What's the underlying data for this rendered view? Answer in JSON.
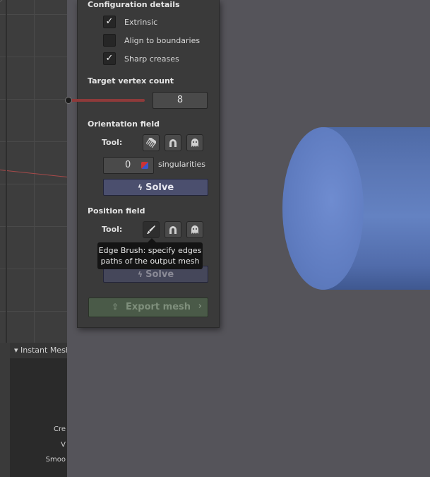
{
  "config": {
    "title": "Configuration details",
    "options": [
      {
        "label": "Extrinsic",
        "checked": true
      },
      {
        "label": "Align to boundaries",
        "checked": false
      },
      {
        "label": "Sharp creases",
        "checked": true
      }
    ]
  },
  "target": {
    "title": "Target vertex count",
    "value": "8"
  },
  "orientation": {
    "title": "Orientation field",
    "tool_label": "Tool:",
    "tools": [
      "comb-icon",
      "magnet-icon",
      "ghost-icon"
    ],
    "singularities_value": "0",
    "singularities_label": "singularities",
    "solve_label": "Solve"
  },
  "position": {
    "title": "Position field",
    "tool_label": "Tool:",
    "tools": [
      "brush-icon",
      "magnet-icon",
      "ghost-icon"
    ],
    "solve_label": "Solve"
  },
  "tooltip": {
    "line1": "Edge Brush: specify edges",
    "line2": "paths of the output mesh"
  },
  "export": {
    "label": "Export mesh",
    "icon": "export-icon"
  },
  "side_panel": {
    "header": "Instant Mesh",
    "rows": [
      "Cre",
      "V",
      "Smoo"
    ]
  },
  "colors": {
    "panel_bg": "#3a3a3a",
    "solve_button": "#4b4f6e",
    "export_button": "#4a5a48",
    "cylinder": "#5f7cc0",
    "slider": "#8e3a3a"
  }
}
